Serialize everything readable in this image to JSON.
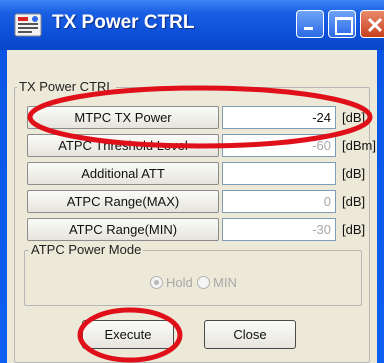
{
  "window": {
    "title": "TX Power CTRL",
    "icon": "app-icon",
    "controls": [
      "minimize-icon",
      "maximize-icon",
      "close-icon"
    ]
  },
  "group_tx": {
    "label": "TX Power CTRL"
  },
  "rows": [
    {
      "label": "MTPC TX Power",
      "value": "-24",
      "unit": "[dB]",
      "enabled": true
    },
    {
      "label": "ATPC Threshold Level",
      "value": "-60",
      "unit": "[dBm]",
      "enabled": false
    },
    {
      "label": "Additional ATT",
      "value": "",
      "unit": "[dB]",
      "enabled": true
    },
    {
      "label": "ATPC Range(MAX)",
      "value": "0",
      "unit": "[dB]",
      "enabled": false
    },
    {
      "label": "ATPC Range(MIN)",
      "value": "-30",
      "unit": "[dB]",
      "enabled": false
    }
  ],
  "group_mode": {
    "label": "ATPC Power Mode",
    "options": [
      {
        "label": "Hold",
        "selected": true
      },
      {
        "label": "MIN",
        "selected": false
      }
    ]
  },
  "buttons": {
    "execute": "Execute",
    "close": "Close"
  },
  "colors": {
    "titlebar": "#0b4fd8",
    "client_bg": "#ece9d8",
    "annotation": "#e0101a"
  }
}
